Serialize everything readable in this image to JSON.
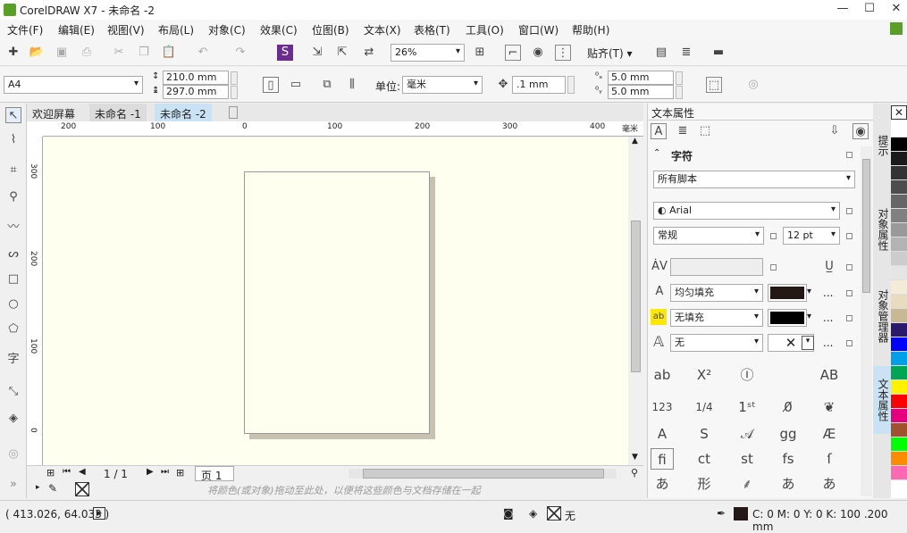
{
  "window": {
    "title": "CorelDRAW X7 - 未命名 -2"
  },
  "menu": [
    "文件(F)",
    "编辑(E)",
    "视图(V)",
    "布局(L)",
    "对象(C)",
    "效果(C)",
    "位图(B)",
    "文本(X)",
    "表格(T)",
    "工具(O)",
    "窗口(W)",
    "帮助(H)"
  ],
  "toolbar": {
    "zoom": "26%",
    "snap": "贴齐(T)"
  },
  "propbar": {
    "page_size": "A4",
    "width": "210.0 mm",
    "height": "297.0 mm",
    "units_label": "单位:",
    "units": "毫米",
    "nudge": ".1 mm",
    "dup_x": "5.0 mm",
    "dup_y": "5.0 mm"
  },
  "tabs": [
    "欢迎屏幕",
    "未命名 -1",
    "未命名 -2"
  ],
  "ruler": {
    "h": [
      "200",
      "100",
      "0",
      "100",
      "200",
      "300",
      "400"
    ],
    "v": [
      "300",
      "200",
      "100",
      "0"
    ],
    "unit": "毫米"
  },
  "pagebar": {
    "count": "1 / 1",
    "page": "页 1"
  },
  "colorbar_hint": "将颜色(或对象)拖动至此处，以便将这些颜色与文档存储在一起",
  "docker": {
    "title": "文本属性",
    "section": "字符",
    "script": "所有脚本",
    "font": "Arial",
    "style": "常规",
    "size": "12 pt",
    "fill1": "均匀填充",
    "fill2": "无填充",
    "outline": "无",
    "ellipsis": "..."
  },
  "sidetabs": [
    "提示",
    "对象属性",
    "对象管理器",
    "文本属性"
  ],
  "status": {
    "coords": "( 413.026, 64.033 )",
    "fill_label": "无",
    "outline": "C: 0 M: 0 Y: 0 K: 100  .200 mm"
  },
  "colors": {
    "accent": "#c9e3f5",
    "canvas": "#fffff0"
  },
  "palette": [
    "#ffffff",
    "#000000",
    "#1a1a1a",
    "#333333",
    "#4d4d4d",
    "#666666",
    "#808080",
    "#999999",
    "#b3b3b3",
    "#cccccc",
    "#e5e5e5",
    "#f2ecd9",
    "#e8dcc0",
    "#c9b894",
    "#2b1a6b",
    "#0000ff",
    "#00a0e9",
    "#00a651",
    "#fff200",
    "#ff0000",
    "#e4007f",
    "#a0522d",
    "#00ff00",
    "#ff8c00",
    "#ff69b4"
  ]
}
